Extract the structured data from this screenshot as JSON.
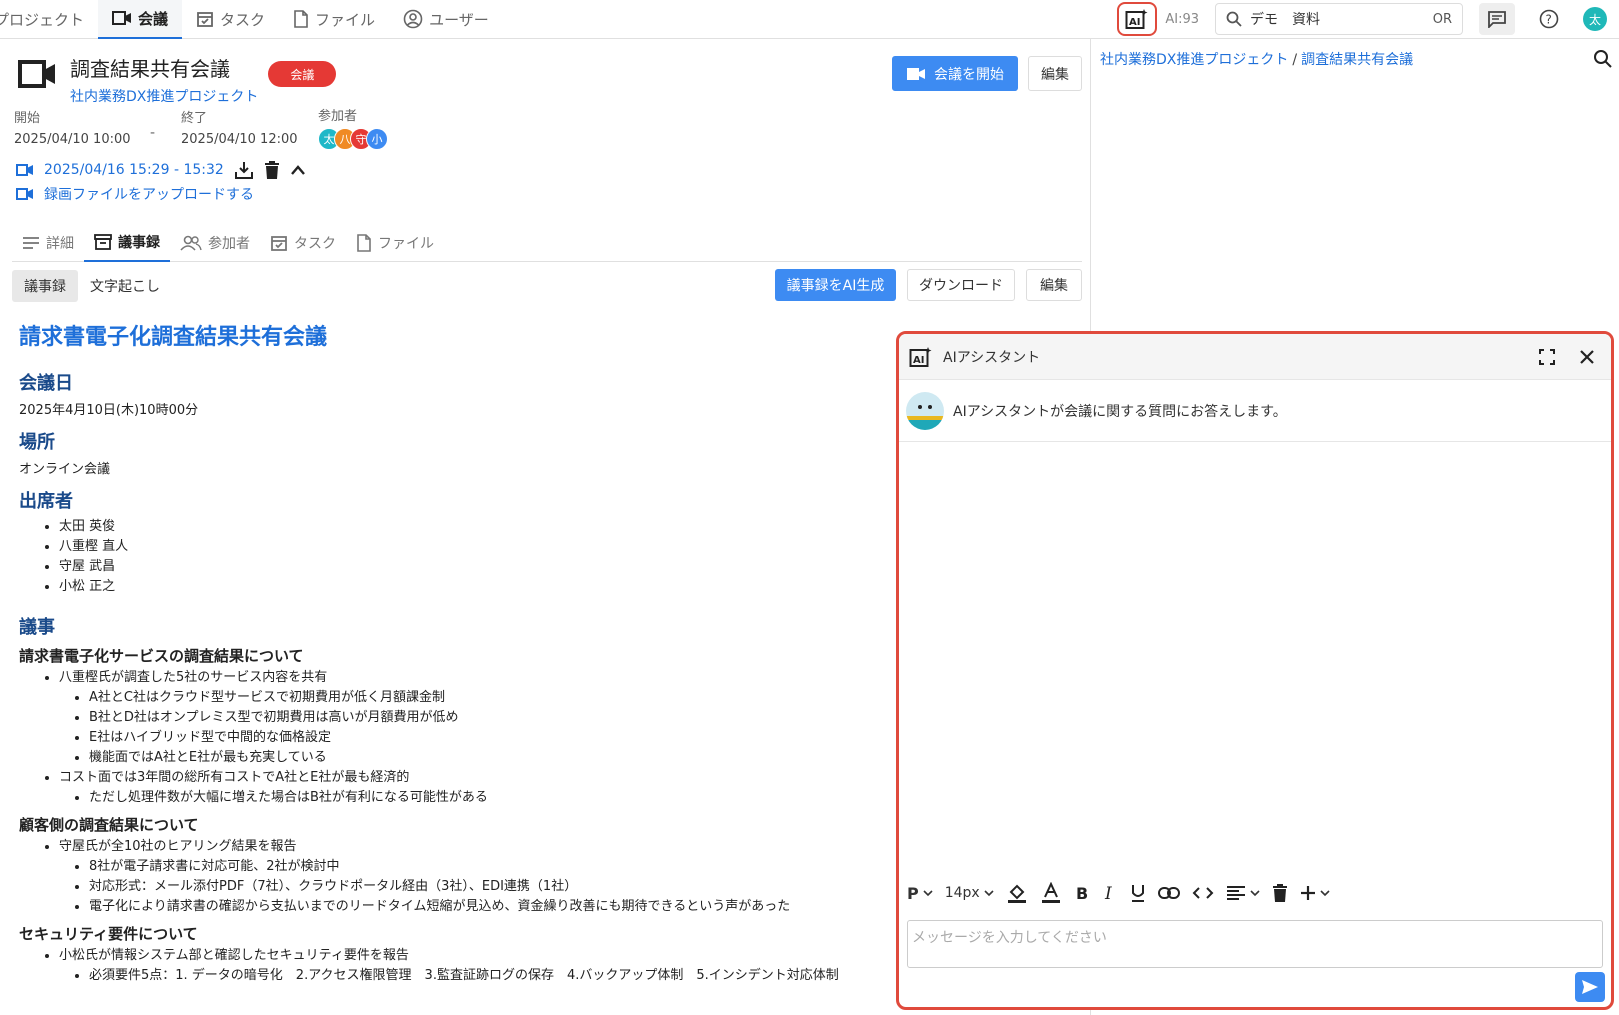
{
  "nav": {
    "items": [
      {
        "label": "プロジェクト",
        "icon": "none"
      },
      {
        "label": "会議",
        "icon": "video-icon"
      },
      {
        "label": "タスク",
        "icon": "calendar-check-icon"
      },
      {
        "label": "ファイル",
        "icon": "file-icon"
      },
      {
        "label": "ユーザー",
        "icon": "user-circle-icon"
      }
    ],
    "active_index": 1,
    "ai_count": "AI:93",
    "search_value": "デモ　資料",
    "search_or": "OR",
    "user_initial": "太"
  },
  "meeting": {
    "title": "調査結果共有会議",
    "project": "社内業務DX推進プロジェクト",
    "badge": "会議",
    "start_button": "会議を開始",
    "edit_button": "編集",
    "start_label": "開始",
    "start_value": "2025/04/10 10:00",
    "dash": "-",
    "end_label": "終了",
    "end_value": "2025/04/10 12:00",
    "participants_label": "参加者",
    "participants": [
      {
        "initial": "太",
        "color": "#1fb8c8"
      },
      {
        "initial": "八",
        "color": "#f08a24"
      },
      {
        "initial": "守",
        "color": "#e53935"
      },
      {
        "initial": "小",
        "color": "#3d8bf2"
      }
    ],
    "recording": "2025/04/16 15:29 - 15:32",
    "upload": "録画ファイルをアップロードする"
  },
  "tabs": [
    {
      "label": "詳細",
      "icon": "list-icon"
    },
    {
      "label": "議事録",
      "icon": "archive-icon"
    },
    {
      "label": "参加者",
      "icon": "users-icon"
    },
    {
      "label": "タスク",
      "icon": "calendar-check-icon"
    },
    {
      "label": "ファイル",
      "icon": "file-icon"
    }
  ],
  "subbar": {
    "tab1": "議事録",
    "tab2": "文字起こし",
    "ai_generate": "議事録をAI生成",
    "download": "ダウンロード",
    "edit": "編集"
  },
  "doc": {
    "title": "請求書電子化調査結果共有会議",
    "date_heading": "会議日",
    "date_value": "2025年4月10日(木)10時00分",
    "place_heading": "場所",
    "place_value": "オンライン会議",
    "attendees_heading": "出席者",
    "attendees": [
      "太田 英俊",
      "八重樫 直人",
      "守屋 武昌",
      "小松 正之"
    ],
    "agenda_heading": "議事",
    "s1_heading": "請求書電子化サービスの調査結果について",
    "s1_item1": "八重樫氏が調査した5社のサービス内容を共有",
    "s1_sub1": [
      "A社とC社はクラウド型サービスで初期費用が低く月額課金制",
      "B社とD社はオンプレミス型で初期費用は高いが月額費用が低め",
      "E社はハイブリッド型で中間的な価格設定",
      "機能面ではA社とE社が最も充実している"
    ],
    "s1_item2": "コスト面では3年間の総所有コストでA社とE社が最も経済的",
    "s1_sub2": [
      "ただし処理件数が大幅に増えた場合はB社が有利になる可能性がある"
    ],
    "s2_heading": "顧客側の調査結果について",
    "s2_item1": "守屋氏が全10社のヒアリング結果を報告",
    "s2_sub1": [
      "8社が電子請求書に対応可能、2社が検討中",
      "対応形式：メール添付PDF（7社）、クラウドポータル経由（3社）、EDI連携（1社）",
      "電子化により請求書の確認から支払いまでのリードタイム短縮が見込め、資金繰り改善にも期待できるという声があった"
    ],
    "s3_heading": "セキュリティ要件について",
    "s3_item1": "小松氏が情報システム部と確認したセキュリティ要件を報告",
    "s3_sub1": [
      "必須要件5点：1. データの暗号化　2.アクセス権限管理　3.監査証跡ログの保存　4.バックアップ体制　5.インシデント対応体制"
    ]
  },
  "breadcrumb": {
    "project": "社内業務DX推進プロジェクト",
    "sep": "/",
    "page": "調査結果共有会議"
  },
  "assistant": {
    "title": "AIアシスタント",
    "greeting": "AIアシスタントが会議に関する質問にお答えします。",
    "toolbar_p": "P",
    "toolbar_size": "14px",
    "placeholder": "メッセージを入力してください"
  }
}
